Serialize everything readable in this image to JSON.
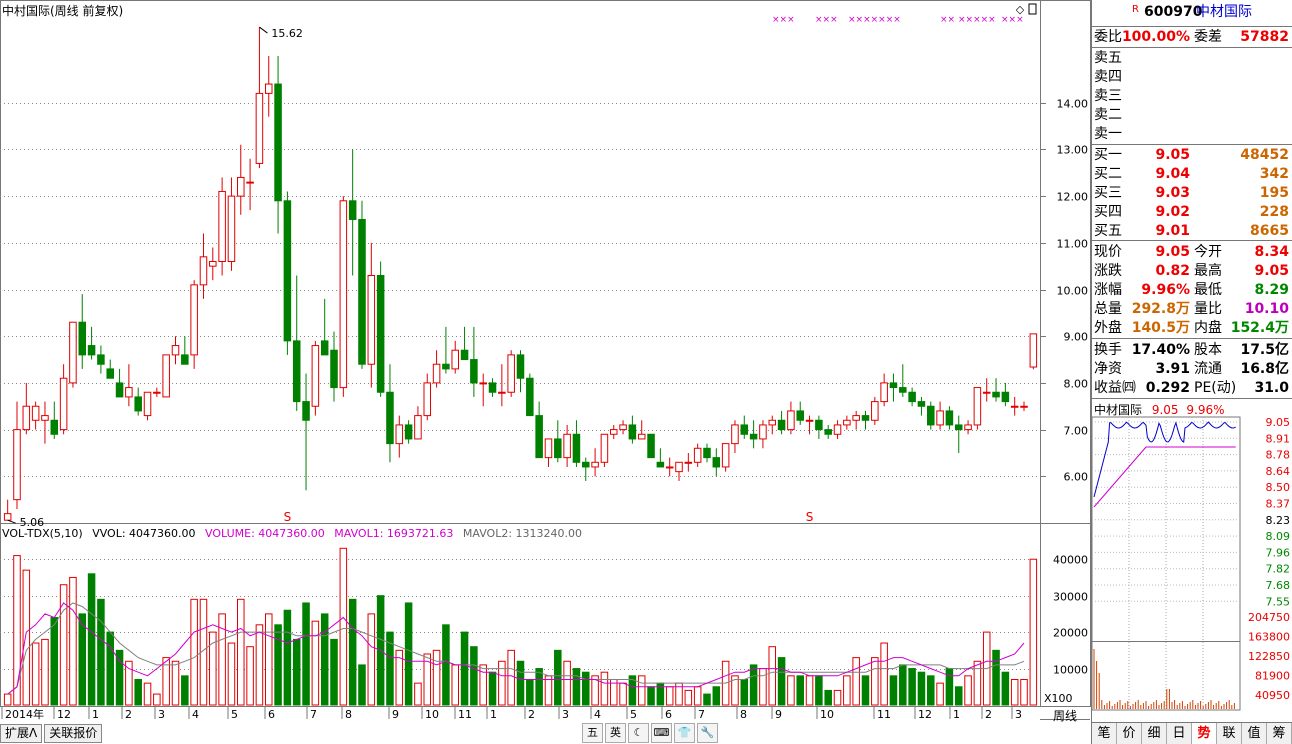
{
  "chart_title": "中村国际(周线 前复权)",
  "vol_header": {
    "name": "VOL-TDX(5,10)",
    "vvol": "VVOL: 4047360.00",
    "volume": "VOLUME: 4047360.00",
    "mavol1": "MAVOL1: 1693721.63",
    "mavol2": "MAVOL2: 1313240.00"
  },
  "colors": {
    "up": "#e00000",
    "down": "#008000",
    "ma1": "#d000d0",
    "ma2": "#808080",
    "grid": "#888888"
  },
  "price_axis_labels": [
    "14.00",
    "13.00",
    "12.00",
    "11.00",
    "10.00",
    "9.00",
    "8.00",
    "7.00",
    "6.00"
  ],
  "vol_axis_labels": [
    "40000",
    "30000",
    "20000",
    "10000"
  ],
  "vol_axis_unit": "X100",
  "time_axis_labels": [
    "2014年",
    "12",
    "1",
    "2",
    "3",
    "4",
    "5",
    "6",
    "7",
    "8",
    "9",
    "10",
    "11",
    "1",
    "2",
    "3",
    "4",
    "5",
    "6",
    "7",
    "8",
    "9",
    "10",
    "11",
    "12",
    "1",
    "2",
    "3"
  ],
  "period_label": "周线",
  "high_marker": "15.62",
  "low_marker": "5.06",
  "s_markers": [
    "S",
    "S"
  ],
  "x_markers": [
    "×××",
    "×××",
    "×××××××",
    "××",
    "×××××",
    "×××"
  ],
  "bottom_tabs": [
    "扩展Λ",
    "关联报价"
  ],
  "tool_icons": [
    "五",
    "英",
    "moon-icon",
    "keyboard-icon",
    "shirt-icon",
    "wrench-icon"
  ],
  "quote": {
    "badge": "R",
    "code": "600970",
    "name": "中材国际",
    "weibi_label": "委比",
    "weibi": "100.00%",
    "weicha_label": "委差",
    "weicha": "57882",
    "sells": [
      "卖五",
      "卖四",
      "卖三",
      "卖二",
      "卖一"
    ],
    "buys": [
      {
        "label": "买一",
        "price": "9.05",
        "vol": "48452"
      },
      {
        "label": "买二",
        "price": "9.04",
        "vol": "342"
      },
      {
        "label": "买三",
        "price": "9.03",
        "vol": "195"
      },
      {
        "label": "买四",
        "price": "9.02",
        "vol": "228"
      },
      {
        "label": "买五",
        "price": "9.01",
        "vol": "8665"
      }
    ],
    "stats": [
      {
        "l1": "现价",
        "v1": "9.05",
        "l2": "今开",
        "v2": "8.34"
      },
      {
        "l1": "涨跌",
        "v1": "0.82",
        "l2": "最高",
        "v2": "9.05"
      },
      {
        "l1": "涨幅",
        "v1": "9.96%",
        "l2": "最低",
        "v2": "8.29"
      },
      {
        "l1": "总量",
        "v1": "292.8万",
        "l2": "量比",
        "v2": "10.10"
      },
      {
        "l1": "外盘",
        "v1": "140.5万",
        "l2": "内盘",
        "v2": "152.4万"
      }
    ],
    "stats2": [
      {
        "l1": "换手",
        "v1": "17.40%",
        "l2": "股本",
        "v2": "17.5亿"
      },
      {
        "l1": "净资",
        "v1": "3.91",
        "l2": "流通",
        "v2": "16.8亿"
      },
      {
        "l1": "收益㈣",
        "v1": "0.292",
        "l2": "PE(动)",
        "v2": "31.0"
      }
    ]
  },
  "mini": {
    "title": "中材国际",
    "price": "9.05",
    "pct": "9.96%",
    "price_labels": [
      "9.05",
      "8.91",
      "8.78",
      "8.64",
      "8.50",
      "8.37",
      "8.23",
      "8.09",
      "7.96",
      "7.82",
      "7.68",
      "7.55"
    ],
    "vol_labels": [
      "204750",
      "163800",
      "122850",
      "81900",
      "40950"
    ]
  },
  "right_tabs": [
    "笔",
    "价",
    "细",
    "日",
    "势",
    "联",
    "值",
    "筹"
  ],
  "right_tab_active": "势",
  "chart_data": {
    "type": "candlestick",
    "title": "中村国际(周线 前复权)",
    "y_range": [
      5.0,
      15.9
    ],
    "vol_range": [
      0,
      45000
    ],
    "candles": [
      [
        5.06,
        5.5,
        5.06,
        5.2
      ],
      [
        5.5,
        7.6,
        5.3,
        7.0
      ],
      [
        7.0,
        8.0,
        6.9,
        7.5
      ],
      [
        7.2,
        7.6,
        7.0,
        7.5
      ],
      [
        7.2,
        7.6,
        6.7,
        7.3
      ],
      [
        7.2,
        7.6,
        6.8,
        6.9
      ],
      [
        7.0,
        8.4,
        6.9,
        8.1
      ],
      [
        8.0,
        9.3,
        7.9,
        9.3
      ],
      [
        9.3,
        9.9,
        8.3,
        8.6
      ],
      [
        8.8,
        9.2,
        8.5,
        8.6
      ],
      [
        8.6,
        8.8,
        8.2,
        8.4
      ],
      [
        8.3,
        8.5,
        8.1,
        8.1
      ],
      [
        8.0,
        8.3,
        7.7,
        7.7
      ],
      [
        7.7,
        8.4,
        7.5,
        7.9
      ],
      [
        7.7,
        7.9,
        7.3,
        7.4
      ],
      [
        7.3,
        7.8,
        7.2,
        7.8
      ],
      [
        7.8,
        7.9,
        7.7,
        7.8
      ],
      [
        7.7,
        8.6,
        7.7,
        8.6
      ],
      [
        8.6,
        9.0,
        8.4,
        8.8
      ],
      [
        8.6,
        9.0,
        8.4,
        8.4
      ],
      [
        8.6,
        10.2,
        8.3,
        10.1
      ],
      [
        10.1,
        11.2,
        9.8,
        10.7
      ],
      [
        10.5,
        10.9,
        10.2,
        10.6
      ],
      [
        10.6,
        12.4,
        10.3,
        12.1
      ],
      [
        10.6,
        12.4,
        10.4,
        12.0
      ],
      [
        12.0,
        13.1,
        11.6,
        12.4
      ],
      [
        12.3,
        12.8,
        11.7,
        12.3
      ],
      [
        12.7,
        15.62,
        12.6,
        14.2
      ],
      [
        14.2,
        15.0,
        13.7,
        14.4
      ],
      [
        14.4,
        15.0,
        11.2,
        11.9
      ],
      [
        11.9,
        12.1,
        8.6,
        8.9
      ],
      [
        8.9,
        10.3,
        7.4,
        7.6
      ],
      [
        7.6,
        8.2,
        5.7,
        7.2
      ],
      [
        7.5,
        8.9,
        7.3,
        8.8
      ],
      [
        8.9,
        9.8,
        8.6,
        8.6
      ],
      [
        8.7,
        9.1,
        7.6,
        7.9
      ],
      [
        7.9,
        12.0,
        7.7,
        11.9
      ],
      [
        11.9,
        13.0,
        10.3,
        11.5
      ],
      [
        11.5,
        11.9,
        8.3,
        8.4
      ],
      [
        8.4,
        11.0,
        7.9,
        10.3
      ],
      [
        10.3,
        10.6,
        7.7,
        7.8
      ],
      [
        7.8,
        8.4,
        6.3,
        6.7
      ],
      [
        6.7,
        7.3,
        6.4,
        7.1
      ],
      [
        7.1,
        7.2,
        6.7,
        6.8
      ],
      [
        6.8,
        7.5,
        6.8,
        7.3
      ],
      [
        7.3,
        8.2,
        7.2,
        8.0
      ],
      [
        8.0,
        8.7,
        7.9,
        8.4
      ],
      [
        8.4,
        9.2,
        8.2,
        8.3
      ],
      [
        8.3,
        8.9,
        8.2,
        8.7
      ],
      [
        8.7,
        9.2,
        8.5,
        8.5
      ],
      [
        8.5,
        9.2,
        7.7,
        8.0
      ],
      [
        8.0,
        8.2,
        7.5,
        8.0
      ],
      [
        8.0,
        8.1,
        7.7,
        7.8
      ],
      [
        7.8,
        8.4,
        7.5,
        7.8
      ],
      [
        7.8,
        8.7,
        7.7,
        8.6
      ],
      [
        8.6,
        8.7,
        7.8,
        8.1
      ],
      [
        8.1,
        8.2,
        7.3,
        7.3
      ],
      [
        7.3,
        7.6,
        6.4,
        6.4
      ],
      [
        6.4,
        6.8,
        6.2,
        6.8
      ],
      [
        6.8,
        7.2,
        6.3,
        6.4
      ],
      [
        6.4,
        7.1,
        6.2,
        6.9
      ],
      [
        6.9,
        7.2,
        6.2,
        6.3
      ],
      [
        6.3,
        6.4,
        5.9,
        6.2
      ],
      [
        6.2,
        6.6,
        6.0,
        6.3
      ],
      [
        6.3,
        6.9,
        6.2,
        6.9
      ],
      [
        6.9,
        7.1,
        6.8,
        7.0
      ],
      [
        7.0,
        7.2,
        6.9,
        7.1
      ],
      [
        7.1,
        7.3,
        6.7,
        6.8
      ],
      [
        6.8,
        7.2,
        6.8,
        6.9
      ],
      [
        6.9,
        6.9,
        6.4,
        6.4
      ],
      [
        6.3,
        6.6,
        6.2,
        6.2
      ],
      [
        6.2,
        6.4,
        6.0,
        6.2
      ],
      [
        6.1,
        6.3,
        5.9,
        6.3
      ],
      [
        6.3,
        6.5,
        6.1,
        6.3
      ],
      [
        6.3,
        6.7,
        6.2,
        6.6
      ],
      [
        6.6,
        6.7,
        6.3,
        6.4
      ],
      [
        6.4,
        6.6,
        6.0,
        6.2
      ],
      [
        6.2,
        6.7,
        6.1,
        6.7
      ],
      [
        6.7,
        7.2,
        6.5,
        7.1
      ],
      [
        7.1,
        7.3,
        6.8,
        6.9
      ],
      [
        6.9,
        7.2,
        6.6,
        6.8
      ],
      [
        6.8,
        7.2,
        6.6,
        7.1
      ],
      [
        7.1,
        7.3,
        6.9,
        7.2
      ],
      [
        7.2,
        7.4,
        6.9,
        7.0
      ],
      [
        7.0,
        7.6,
        6.9,
        7.4
      ],
      [
        7.4,
        7.6,
        7.1,
        7.2
      ],
      [
        7.2,
        7.3,
        6.9,
        7.2
      ],
      [
        7.2,
        7.3,
        6.8,
        7.0
      ],
      [
        7.0,
        7.1,
        6.8,
        6.9
      ],
      [
        6.9,
        7.2,
        6.8,
        7.1
      ],
      [
        7.1,
        7.3,
        7.0,
        7.2
      ],
      [
        7.2,
        7.4,
        7.0,
        7.3
      ],
      [
        7.3,
        7.4,
        7.0,
        7.2
      ],
      [
        7.2,
        7.7,
        7.1,
        7.6
      ],
      [
        7.6,
        8.2,
        7.5,
        8.0
      ],
      [
        8.0,
        8.2,
        7.6,
        7.9
      ],
      [
        7.9,
        8.4,
        7.7,
        7.8
      ],
      [
        7.8,
        7.9,
        7.5,
        7.6
      ],
      [
        7.6,
        7.7,
        7.3,
        7.5
      ],
      [
        7.5,
        7.6,
        7.0,
        7.1
      ],
      [
        7.1,
        7.6,
        7.0,
        7.4
      ],
      [
        7.4,
        7.5,
        7.0,
        7.1
      ],
      [
        7.1,
        7.3,
        6.5,
        7.0
      ],
      [
        7.0,
        7.2,
        6.9,
        7.1
      ],
      [
        7.1,
        7.9,
        7.0,
        7.9
      ],
      [
        7.8,
        8.1,
        7.6,
        7.8
      ],
      [
        7.8,
        8.1,
        7.6,
        7.7
      ],
      [
        7.8,
        8.0,
        7.5,
        7.6
      ],
      [
        7.5,
        7.7,
        7.3,
        7.5
      ],
      [
        7.5,
        7.6,
        7.4,
        7.5
      ],
      [
        8.34,
        9.05,
        8.29,
        9.05
      ]
    ],
    "volumes": [
      3000,
      41000,
      37000,
      17000,
      18000,
      24000,
      33000,
      35000,
      25000,
      36000,
      29000,
      20000,
      15000,
      12000,
      7000,
      6000,
      3000,
      13000,
      12000,
      8000,
      29000,
      29000,
      20000,
      25000,
      17000,
      29000,
      16000,
      22000,
      25000,
      22000,
      26000,
      18000,
      28000,
      23000,
      25000,
      18000,
      43000,
      29000,
      11000,
      25000,
      30000,
      20000,
      15000,
      28000,
      6000,
      14000,
      15000,
      22000,
      11000,
      20000,
      16000,
      11000,
      9000,
      12000,
      15000,
      12000,
      7000,
      10000,
      8000,
      15000,
      12000,
      10000,
      9000,
      8000,
      9000,
      7000,
      6000,
      8000,
      8000,
      5000,
      6000,
      5000,
      6000,
      4000,
      5000,
      3000,
      5000,
      12000,
      8000,
      7000,
      11000,
      10000,
      16000,
      13000,
      8000,
      8000,
      8000,
      8000,
      4000,
      4000,
      8000,
      13000,
      8000,
      13000,
      17000,
      8000,
      11000,
      10000,
      9000,
      8000,
      6000,
      10000,
      5000,
      8000,
      12000,
      20000,
      15000,
      9000,
      7000,
      7000,
      40000
    ],
    "ma1": [
      3,
      5,
      20,
      22,
      25,
      24,
      28,
      26,
      22,
      20,
      18,
      16,
      12,
      10,
      9,
      8,
      10,
      12,
      14,
      17,
      20,
      21,
      22,
      21,
      20,
      21,
      19,
      20,
      19,
      18,
      17,
      18,
      19,
      19,
      20,
      22,
      24,
      21,
      19,
      16,
      15,
      13,
      13,
      12,
      12,
      12,
      11,
      12,
      11,
      11,
      10,
      9,
      9,
      8,
      8,
      7,
      7,
      7,
      7,
      7,
      7,
      7,
      7,
      7,
      6,
      6,
      6,
      5,
      5,
      5,
      5,
      5,
      5,
      5,
      5,
      6,
      7,
      8,
      9,
      9,
      10,
      10,
      10,
      10,
      9,
      9,
      8,
      8,
      8,
      8,
      9,
      10,
      11,
      12,
      12,
      13,
      13,
      12,
      11,
      10,
      9,
      8,
      8,
      10,
      11,
      12,
      12,
      13,
      14,
      17
    ],
    "ma2": [
      3,
      5,
      15,
      18,
      20,
      22,
      26,
      28,
      27,
      25,
      23,
      20,
      17,
      15,
      13,
      12,
      11,
      11,
      11,
      12,
      13,
      15,
      17,
      18,
      19,
      20,
      20,
      20,
      20,
      20,
      20,
      19,
      19,
      19,
      19,
      20,
      21,
      21,
      20,
      19,
      18,
      17,
      16,
      15,
      14,
      13,
      12,
      12,
      11,
      11,
      11,
      10,
      10,
      10,
      10,
      9,
      9,
      9,
      8,
      8,
      8,
      8,
      7,
      7,
      7,
      7,
      7,
      7,
      6,
      6,
      6,
      6,
      6,
      6,
      6,
      6,
      6,
      6,
      7,
      7,
      8,
      8,
      9,
      9,
      9,
      9,
      9,
      9,
      9,
      9,
      9,
      9,
      9,
      10,
      10,
      10,
      11,
      11,
      11,
      11,
      11,
      10,
      10,
      10,
      10,
      10,
      11,
      11,
      11,
      12
    ]
  }
}
